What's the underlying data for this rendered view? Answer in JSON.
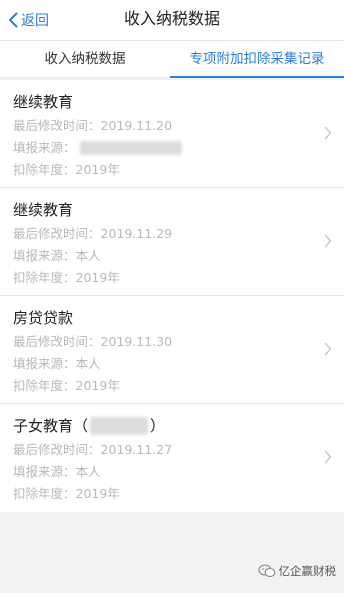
{
  "navbar": {
    "back_label": "返回",
    "title": "收入纳税数据"
  },
  "tabs": [
    {
      "label": "收入纳税数据",
      "active": false
    },
    {
      "label": "专项附加扣除采集记录",
      "active": true
    }
  ],
  "records": [
    {
      "title": "继续教育",
      "modified": "最后修改时间：2019.11.20",
      "source_label": "填报来源：",
      "source_value": "",
      "year": "扣除年度：2019年"
    },
    {
      "title": "继续教育",
      "modified": "最后修改时间：2019.11.29",
      "source_label": "填报来源：",
      "source_value": "本人",
      "year": "扣除年度：2019年"
    },
    {
      "title": "房贷贷款",
      "modified": "最后修改时间：2019.11.30",
      "source_label": "填报来源：",
      "source_value": "本人",
      "year": "扣除年度：2019年"
    },
    {
      "title": "子女教育（",
      "title_suffix": "）",
      "modified": "最后修改时间：2019.11.27",
      "source_label": "填报来源：",
      "source_value": "本人",
      "year": "扣除年度：2019年"
    }
  ],
  "watermark": {
    "text": "亿企赢财税",
    "icon": "wechat-icon"
  },
  "colors": {
    "accent": "#2b7de0",
    "secondary_text": "#b8b8bd",
    "background": "#f2f2f4"
  }
}
